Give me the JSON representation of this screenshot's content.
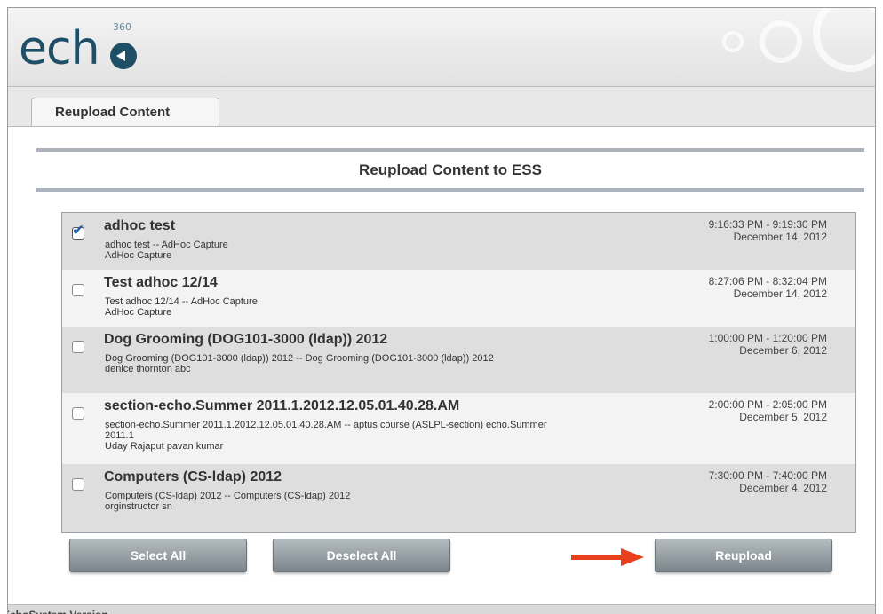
{
  "app": {
    "logo_text": "ech",
    "logo_superscript": "360"
  },
  "tabs": [
    {
      "label": "Reupload Content"
    }
  ],
  "section": {
    "title": "Reupload Content to ESS"
  },
  "items": [
    {
      "checked": true,
      "title": "adhoc test",
      "subtitle": "adhoc test -- AdHoc Capture",
      "line2": "AdHoc Capture",
      "time_range": "9:16:33 PM - 9:19:30 PM",
      "date": "December 14, 2012"
    },
    {
      "checked": false,
      "title": "Test adhoc 12/14",
      "subtitle": "Test adhoc 12/14 -- AdHoc Capture",
      "line2": "AdHoc Capture",
      "time_range": "8:27:06 PM - 8:32:04 PM",
      "date": "December 14, 2012"
    },
    {
      "checked": false,
      "title": "Dog Grooming (DOG101-3000 (ldap)) 2012",
      "subtitle": "Dog Grooming (DOG101-3000 (ldap)) 2012 -- Dog Grooming (DOG101-3000 (ldap)) 2012",
      "line2": "denice thornton abc",
      "time_range": "1:00:00 PM - 1:20:00 PM",
      "date": "December 6, 2012"
    },
    {
      "checked": false,
      "title": "section-echo.Summer 2011.1.2012.12.05.01.40.28.AM",
      "subtitle": "section-echo.Summer 2011.1.2012.12.05.01.40.28.AM -- aptus course (ASLPL-section) echo.Summer 2011.1",
      "line2": "Uday Rajaput pavan kumar",
      "time_range": "2:00:00 PM - 2:05:00 PM",
      "date": "December 5, 2012"
    },
    {
      "checked": false,
      "title": "Computers (CS-ldap) 2012",
      "subtitle": "Computers (CS-ldap) 2012 -- Computers (CS-ldap) 2012",
      "line2": "orginstructor sn",
      "time_range": "7:30:00 PM - 7:40:00 PM",
      "date": "December 4, 2012"
    }
  ],
  "buttons": {
    "select_all": "Select All",
    "deselect_all": "Deselect All",
    "reupload": "Reupload"
  },
  "footer": {
    "text": "EchoSystem Version"
  },
  "colors": {
    "logo": "#1f4f67",
    "arrow": "#e8401c",
    "checkmark": "#1f5fa8",
    "button": "#8c959b"
  },
  "icons": {
    "annotation_arrow": "arrow-right-icon",
    "checkmark": "checkmark-icon"
  }
}
